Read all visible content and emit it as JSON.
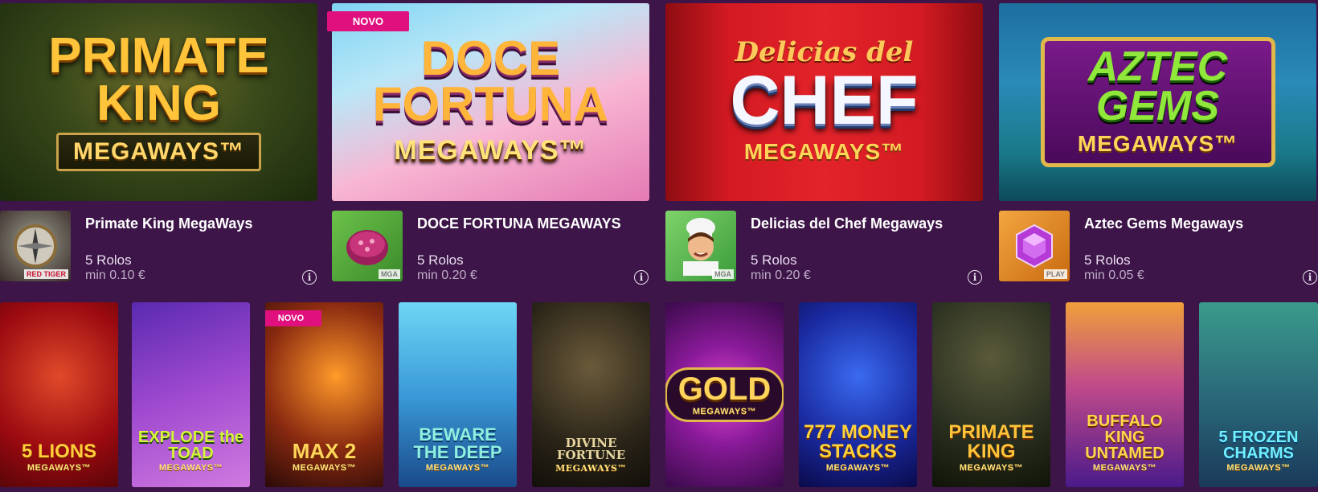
{
  "featured": [
    {
      "art_title": "PRIMATE KING",
      "art_sub": "MEGAWAYS™",
      "title": "Primate King MegaWays",
      "reels": "5 Rolos",
      "min": "min 0.10 €",
      "provider_tag": "RED TIGER",
      "provider_icon": "compass-icon",
      "badge": ""
    },
    {
      "art_title": "DOCE FORTUNA",
      "art_sub": "MEGAWAYS™",
      "title": "DOCE FORTUNA MEGAWAYS",
      "reels": "5 Rolos",
      "min": "min 0.20 €",
      "provider_tag": "MGA",
      "provider_icon": "candy-icon",
      "badge": "NOVO"
    },
    {
      "art_title_script": "Delicias del",
      "art_title": "CHEF",
      "art_sub": "MEGAWAYS™",
      "title": "Delicias del Chef Megaways",
      "reels": "5 Rolos",
      "min": "min 0.20 €",
      "provider_tag": "MGA",
      "provider_icon": "chef-icon",
      "badge": ""
    },
    {
      "art_title": "AZTEC GEMS",
      "art_sub": "MEGAWAYS™",
      "title": "Aztec Gems Megaways",
      "reels": "5 Rolos",
      "min": "min 0.05 €",
      "provider_tag": "PLAY",
      "provider_icon": "gem-icon",
      "badge": ""
    }
  ],
  "small_games": [
    {
      "line1": "5 LIONS",
      "line2": "MEGAWAYS™",
      "badge": ""
    },
    {
      "line1": "EXPLODE the TOAD",
      "line2": "MEGAWAYS™",
      "badge": ""
    },
    {
      "line1": "MAX 2",
      "line2": "MEGAWAYS™",
      "badge": "NOVO"
    },
    {
      "line1": "BEWARE THE DEEP",
      "line2": "MEGAWAYS™",
      "badge": ""
    },
    {
      "line1": "DIVINE FORTUNE",
      "line2": "MEGAWAYS™",
      "badge": ""
    },
    {
      "line1": "GOLD",
      "line2": "MEGAWAYS™",
      "badge": ""
    },
    {
      "line1": "777 MONEY STACKS",
      "line2": "MEGAWAYS™",
      "badge": ""
    },
    {
      "line1": "PRIMATE KING",
      "line2": "MEGAWAYS™",
      "badge": ""
    },
    {
      "line1": "BUFFALO KING UNTAMED",
      "line2": "MEGAWAYS™",
      "badge": ""
    },
    {
      "line1": "5 FROZEN CHARMS",
      "line2": "MEGAWAYS™",
      "badge": ""
    }
  ],
  "info_icon": "i",
  "colors": {
    "background": "#3d1548",
    "badge": "#e0117f",
    "title_text": "#ffffff",
    "meta_text": "#bfaec9"
  }
}
